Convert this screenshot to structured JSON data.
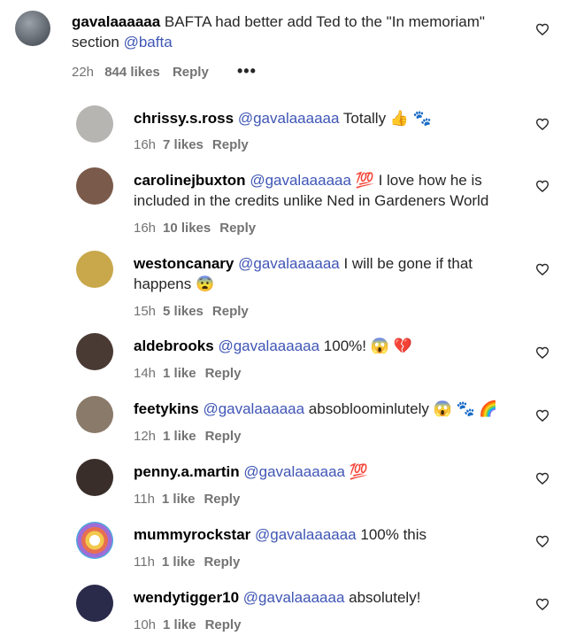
{
  "top_comment": {
    "username": "gavalaaaaaa",
    "text": " BAFTA had better add Ted to the \"In memoriam\" section ",
    "mention": "@bafta",
    "time": "22h",
    "likes": "844 likes",
    "reply": "Reply",
    "more": "•••"
  },
  "replies": [
    {
      "username": "chrissy.s.ross",
      "mention": "@gavalaaaaaa",
      "text": " Totally 👍 🐾",
      "time": "16h",
      "likes": "7 likes",
      "reply": "Reply",
      "avatar": "#b7b5b2"
    },
    {
      "username": "carolinejbuxton",
      "mention": "@gavalaaaaaa",
      "text": " 💯 I love how he is included in the credits unlike Ned in Gardeners World",
      "time": "16h",
      "likes": "10 likes",
      "reply": "Reply",
      "avatar": "#7a5a4a"
    },
    {
      "username": "westoncanary",
      "mention": "@gavalaaaaaa",
      "text": " I will be gone if that happens 😨",
      "time": "15h",
      "likes": "5 likes",
      "reply": "Reply",
      "avatar": "#c8a84a"
    },
    {
      "username": "aldebrooks",
      "mention": "@gavalaaaaaa",
      "text": " 100%! 😱 💔",
      "time": "14h",
      "likes": "1 like",
      "reply": "Reply",
      "avatar": "#4a3a34"
    },
    {
      "username": "feetykins",
      "mention": "@gavalaaaaaa",
      "text": " absobloominlutely 😱 🐾 🌈",
      "time": "12h",
      "likes": "1 like",
      "reply": "Reply",
      "avatar": "#8a7a6a"
    },
    {
      "username": "penny.a.martin",
      "mention": "@gavalaaaaaa",
      "text": " 💯",
      "time": "11h",
      "likes": "1 like",
      "reply": "Reply",
      "avatar": "#3a2e2a"
    },
    {
      "username": "mummyrockstar",
      "mention": "@gavalaaaaaa",
      "text": " 100% this",
      "time": "11h",
      "likes": "1 like",
      "reply": "Reply",
      "avatar": "#e0a040"
    },
    {
      "username": "wendytigger10",
      "mention": "@gavalaaaaaa",
      "text": " absolutely!",
      "time": "10h",
      "likes": "1 like",
      "reply": "Reply",
      "avatar": "#2a2a4a"
    }
  ],
  "icons": {
    "like": "heart-icon",
    "more": "more-options-icon"
  }
}
